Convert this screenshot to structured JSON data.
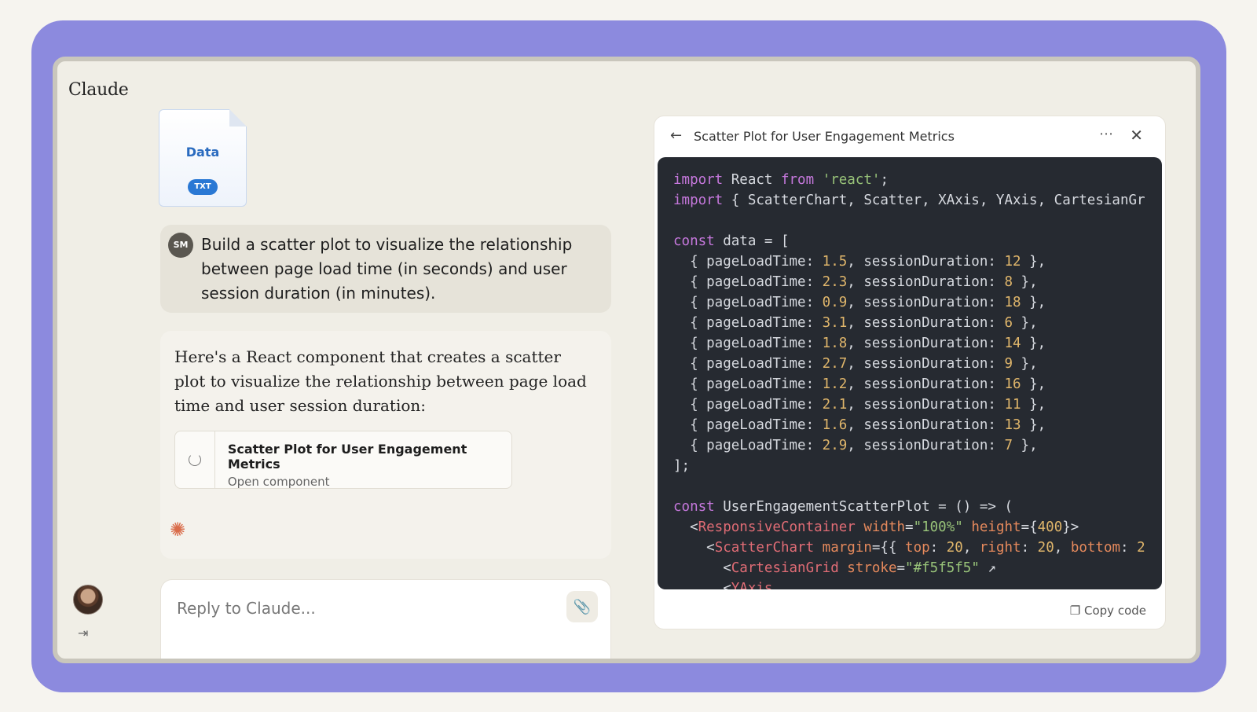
{
  "app": {
    "brand": "Claude"
  },
  "attachment": {
    "name": "Data",
    "type": "TXT"
  },
  "user_message": {
    "initials": "SM",
    "text": "Build a scatter plot to visualize the relationship between page load time (in seconds) and user session duration (in minutes)."
  },
  "assistant_message": {
    "text": "Here's a React component that creates a scatter plot to visualize the relationship between page load time and user session duration:",
    "artifact": {
      "title": "Scatter Plot for User Engagement Metrics",
      "subtitle": "Open component"
    }
  },
  "composer": {
    "placeholder": "Reply to Claude..."
  },
  "panel": {
    "title": "Scatter Plot for User Engagement Metrics",
    "copy_label": "Copy code",
    "more_icon": "ellipsis-icon",
    "close_icon": "close-icon"
  },
  "code_lines": [
    [
      [
        "kw",
        "import"
      ],
      [
        "txt",
        " React "
      ],
      [
        "kw",
        "from"
      ],
      [
        "txt",
        " "
      ],
      [
        "str",
        "'react'"
      ],
      [
        "txt",
        ";"
      ]
    ],
    [
      [
        "kw",
        "import"
      ],
      [
        "txt",
        " { ScatterChart, Scatter, XAxis, YAxis, CartesianGr"
      ]
    ],
    [
      [
        "txt",
        ""
      ]
    ],
    [
      [
        "kw",
        "const"
      ],
      [
        "txt",
        " data = ["
      ]
    ],
    [
      [
        "txt",
        "  { pageLoadTime: "
      ],
      [
        "num",
        "1.5"
      ],
      [
        "txt",
        ", sessionDuration: "
      ],
      [
        "num",
        "12"
      ],
      [
        "txt",
        " },"
      ]
    ],
    [
      [
        "txt",
        "  { pageLoadTime: "
      ],
      [
        "num",
        "2.3"
      ],
      [
        "txt",
        ", sessionDuration: "
      ],
      [
        "num",
        "8"
      ],
      [
        "txt",
        " },"
      ]
    ],
    [
      [
        "txt",
        "  { pageLoadTime: "
      ],
      [
        "num",
        "0.9"
      ],
      [
        "txt",
        ", sessionDuration: "
      ],
      [
        "num",
        "18"
      ],
      [
        "txt",
        " },"
      ]
    ],
    [
      [
        "txt",
        "  { pageLoadTime: "
      ],
      [
        "num",
        "3.1"
      ],
      [
        "txt",
        ", sessionDuration: "
      ],
      [
        "num",
        "6"
      ],
      [
        "txt",
        " },"
      ]
    ],
    [
      [
        "txt",
        "  { pageLoadTime: "
      ],
      [
        "num",
        "1.8"
      ],
      [
        "txt",
        ", sessionDuration: "
      ],
      [
        "num",
        "14"
      ],
      [
        "txt",
        " },"
      ]
    ],
    [
      [
        "txt",
        "  { pageLoadTime: "
      ],
      [
        "num",
        "2.7"
      ],
      [
        "txt",
        ", sessionDuration: "
      ],
      [
        "num",
        "9"
      ],
      [
        "txt",
        " },"
      ]
    ],
    [
      [
        "txt",
        "  { pageLoadTime: "
      ],
      [
        "num",
        "1.2"
      ],
      [
        "txt",
        ", sessionDuration: "
      ],
      [
        "num",
        "16"
      ],
      [
        "txt",
        " },"
      ]
    ],
    [
      [
        "txt",
        "  { pageLoadTime: "
      ],
      [
        "num",
        "2.1"
      ],
      [
        "txt",
        ", sessionDuration: "
      ],
      [
        "num",
        "11"
      ],
      [
        "txt",
        " },"
      ]
    ],
    [
      [
        "txt",
        "  { pageLoadTime: "
      ],
      [
        "num",
        "1.6"
      ],
      [
        "txt",
        ", sessionDuration: "
      ],
      [
        "num",
        "13"
      ],
      [
        "txt",
        " },"
      ]
    ],
    [
      [
        "txt",
        "  { pageLoadTime: "
      ],
      [
        "num",
        "2.9"
      ],
      [
        "txt",
        ", sessionDuration: "
      ],
      [
        "num",
        "7"
      ],
      [
        "txt",
        " },"
      ]
    ],
    [
      [
        "txt",
        "];"
      ]
    ],
    [
      [
        "txt",
        ""
      ]
    ],
    [
      [
        "kw",
        "const"
      ],
      [
        "txt",
        " UserEngagementScatterPlot = () => ("
      ]
    ],
    [
      [
        "txt",
        "  <"
      ],
      [
        "tag",
        "ResponsiveContainer"
      ],
      [
        "txt",
        " "
      ],
      [
        "attr",
        "width"
      ],
      [
        "txt",
        "="
      ],
      [
        "str",
        "\"100%\""
      ],
      [
        "txt",
        " "
      ],
      [
        "attr",
        "height"
      ],
      [
        "txt",
        "={"
      ],
      [
        "num",
        "400"
      ],
      [
        "txt",
        "}>"
      ]
    ],
    [
      [
        "txt",
        "    <"
      ],
      [
        "tag",
        "ScatterChart"
      ],
      [
        "txt",
        " "
      ],
      [
        "attr",
        "margin"
      ],
      [
        "txt",
        "={{ "
      ],
      [
        "attr",
        "top"
      ],
      [
        "txt",
        ": "
      ],
      [
        "num",
        "20"
      ],
      [
        "txt",
        ", "
      ],
      [
        "attr",
        "right"
      ],
      [
        "txt",
        ": "
      ],
      [
        "num",
        "20"
      ],
      [
        "txt",
        ", "
      ],
      [
        "attr",
        "bottom"
      ],
      [
        "txt",
        ": "
      ],
      [
        "num",
        "2"
      ]
    ],
    [
      [
        "txt",
        "      <"
      ],
      [
        "tag",
        "CartesianGrid"
      ],
      [
        "txt",
        " "
      ],
      [
        "attr",
        "stroke"
      ],
      [
        "txt",
        "="
      ],
      [
        "str",
        "\"#f5f5f5\""
      ],
      [
        "txt",
        " ↗"
      ]
    ],
    [
      [
        "txt",
        "      <"
      ],
      [
        "tag",
        "YAxis"
      ]
    ]
  ]
}
